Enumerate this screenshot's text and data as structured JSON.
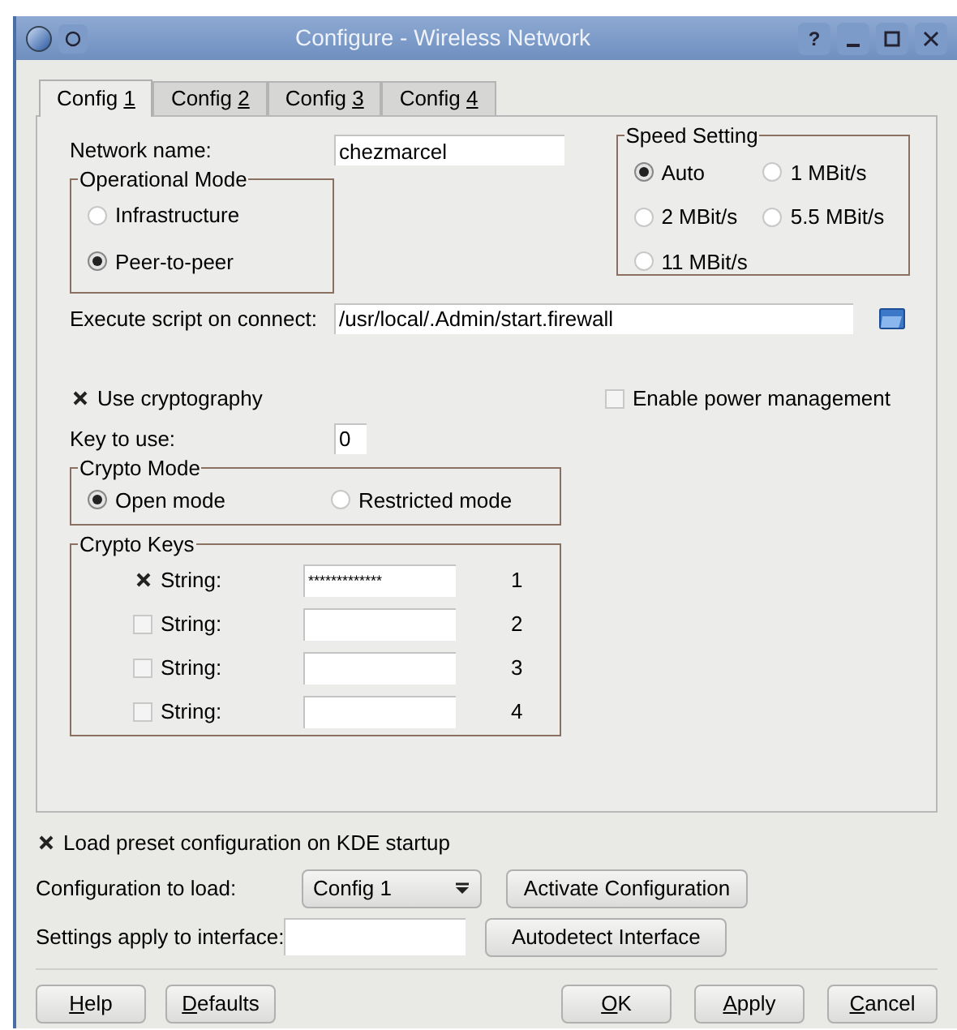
{
  "window": {
    "title": "Configure - Wireless Network",
    "controls": [
      "?"
    ]
  },
  "tabs": [
    {
      "pre": "Config ",
      "key": "1",
      "selected": true
    },
    {
      "pre": "Config ",
      "key": "2",
      "selected": false
    },
    {
      "pre": "Config ",
      "key": "3",
      "selected": false
    },
    {
      "pre": "Config ",
      "key": "4",
      "selected": false
    }
  ],
  "network_name": {
    "label": "Network name:",
    "value": "chezmarcel"
  },
  "operational_mode": {
    "title": "Operational Mode",
    "options": [
      {
        "label": "Infrastructure",
        "selected": false
      },
      {
        "label": "Peer-to-peer",
        "selected": true
      }
    ]
  },
  "speed_setting": {
    "title": "Speed Setting",
    "options": [
      {
        "label": "Auto",
        "selected": true
      },
      {
        "label": "1 MBit/s",
        "selected": false
      },
      {
        "label": "2 MBit/s",
        "selected": false
      },
      {
        "label": "5.5 MBit/s",
        "selected": false
      },
      {
        "label": "11 MBit/s",
        "selected": false
      }
    ]
  },
  "execute_script": {
    "label": "Execute script on connect:",
    "value": "/usr/local/.Admin/start.firewall"
  },
  "use_cryptography": {
    "label": "Use cryptography",
    "checked": true
  },
  "power_management": {
    "label": "Enable power management",
    "checked": false
  },
  "key_to_use": {
    "label": "Key to use:",
    "value": "0"
  },
  "crypto_mode": {
    "title": "Crypto Mode",
    "options": [
      {
        "label": "Open mode",
        "selected": true
      },
      {
        "label": "Restricted mode",
        "selected": false
      }
    ]
  },
  "crypto_keys": {
    "title": "Crypto Keys",
    "rows": [
      {
        "label": "String:",
        "checked": true,
        "value": "*************",
        "number": "1"
      },
      {
        "label": "String:",
        "checked": false,
        "number": "2"
      },
      {
        "label": "String:",
        "checked": false,
        "number": "3"
      },
      {
        "label": "String:",
        "checked": false,
        "number": "4"
      }
    ]
  },
  "load_preset": {
    "label": "Load preset configuration on KDE startup",
    "checked": true
  },
  "config_to_load": {
    "label": "Configuration to load:",
    "value": "Config 1"
  },
  "activate_button": "Activate Configuration",
  "settings_interface": {
    "label": "Settings apply to interface:"
  },
  "autodetect_button": "Autodetect Interface",
  "left_buttons": [
    {
      "key": "H",
      "post": "elp"
    },
    {
      "key": "D",
      "post": "efaults"
    }
  ],
  "right_buttons": [
    {
      "key": "O",
      "post": "K"
    },
    {
      "key": "A",
      "post": "pply"
    },
    {
      "key": "C",
      "post": "ancel"
    }
  ]
}
